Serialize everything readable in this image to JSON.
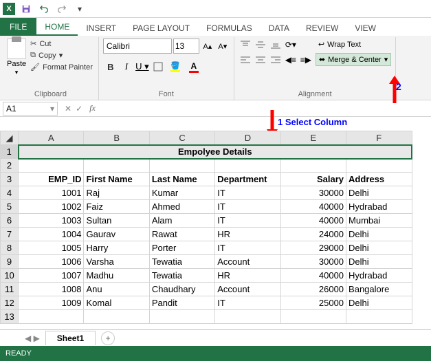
{
  "qat": {
    "save": "💾",
    "undo": "↶",
    "redo": "↷"
  },
  "tabs": [
    "FILE",
    "HOME",
    "INSERT",
    "PAGE LAYOUT",
    "FORMULAS",
    "DATA",
    "REVIEW",
    "VIEW"
  ],
  "ribbon": {
    "paste": "Paste",
    "cut": "Cut",
    "copy": "Copy",
    "painter": "Format Painter",
    "clipboard_label": "Clipboard",
    "font_name": "Calibri",
    "font_size": "13",
    "font_label": "Font",
    "wrap": "Wrap Text",
    "merge": "Merge & Center",
    "align_label": "Alignment"
  },
  "namebox": "A1",
  "annotations": {
    "a1": "1  Select Column",
    "a2": "2"
  },
  "cols": [
    "A",
    "B",
    "C",
    "D",
    "E",
    "F"
  ],
  "merged_title": "Empolyee Details",
  "headers": [
    "EMP_ID",
    "First Name",
    "Last Name",
    "Department",
    "Salary",
    "Address"
  ],
  "rows": [
    {
      "id": "1001",
      "fn": "Raj",
      "ln": "Kumar",
      "dept": "IT",
      "sal": "30000",
      "addr": "Delhi"
    },
    {
      "id": "1002",
      "fn": "Faiz",
      "ln": "Ahmed",
      "dept": "IT",
      "sal": "40000",
      "addr": "Hydrabad"
    },
    {
      "id": "1003",
      "fn": "Sultan",
      "ln": "Alam",
      "dept": "IT",
      "sal": "40000",
      "addr": "Mumbai"
    },
    {
      "id": "1004",
      "fn": "Gaurav",
      "ln": "Rawat",
      "dept": "HR",
      "sal": "24000",
      "addr": "Delhi"
    },
    {
      "id": "1005",
      "fn": "Harry",
      "ln": "Porter",
      "dept": "IT",
      "sal": "29000",
      "addr": "Delhi"
    },
    {
      "id": "1006",
      "fn": "Varsha",
      "ln": "Tewatia",
      "dept": "Account",
      "sal": "30000",
      "addr": "Delhi"
    },
    {
      "id": "1007",
      "fn": "Madhu",
      "ln": "Tewatia",
      "dept": "HR",
      "sal": "40000",
      "addr": "Hydrabad"
    },
    {
      "id": "1008",
      "fn": "Anu",
      "ln": "Chaudhary",
      "dept": "Account",
      "sal": "26000",
      "addr": "Bangalore"
    },
    {
      "id": "1009",
      "fn": "Komal",
      "ln": "Pandit",
      "dept": "IT",
      "sal": "25000",
      "addr": "Delhi"
    }
  ],
  "sheet": "Sheet1",
  "status": "READY"
}
